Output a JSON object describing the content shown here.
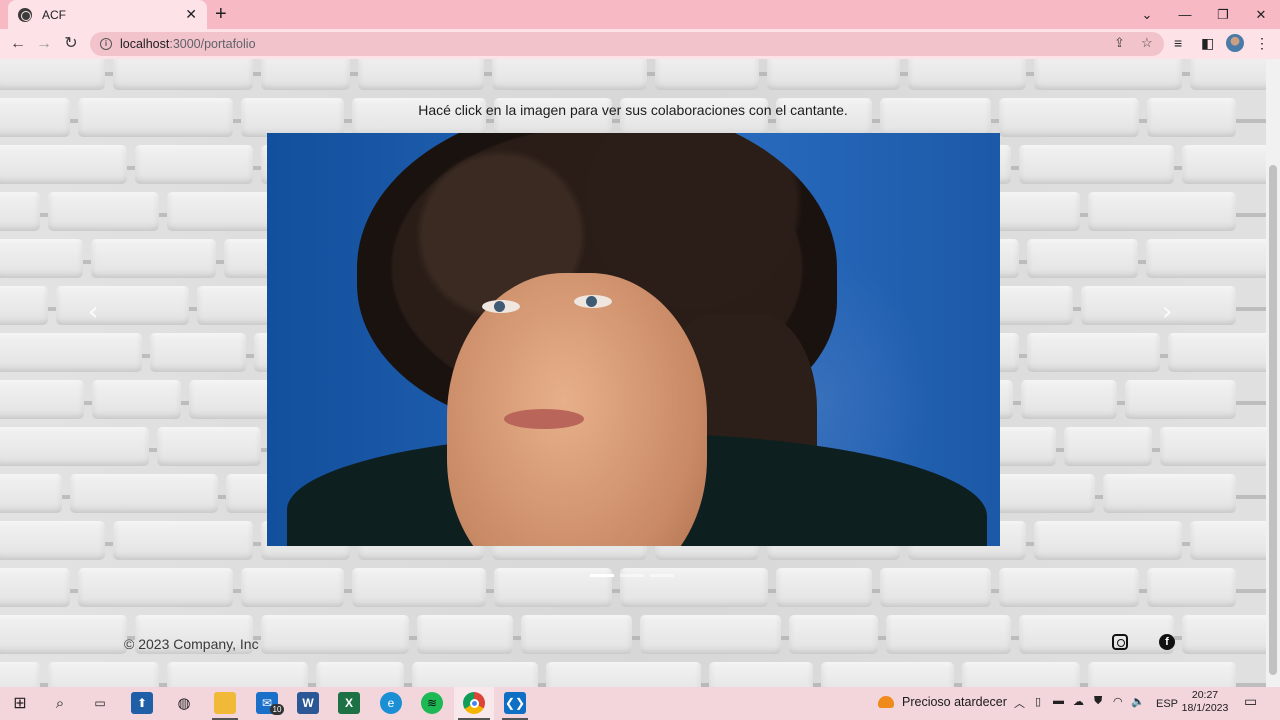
{
  "browser": {
    "tab_title": "ACF",
    "tab_close": "✕",
    "new_tab": "+",
    "url_host": "localhost",
    "url_path": ":3000/portafolio",
    "window_controls": [
      "⌄",
      "—",
      "❐",
      "✕"
    ]
  },
  "page": {
    "hint": "Hacé click en la imagen para ver sus colaboraciones con el cantante.",
    "carousel": {
      "prev": "‹",
      "next": "›",
      "slide_count": 3,
      "active_index": 0
    },
    "footer": {
      "copyright": "© 2023 Company, Inc",
      "social": [
        "instagram-icon",
        "facebook-icon"
      ]
    }
  },
  "taskbar": {
    "apps": [
      "start-icon",
      "search-icon",
      "task-view-icon",
      "app-icon",
      "globe-app-icon",
      "file-explorer-icon",
      "mail-icon",
      "word-icon",
      "excel-icon",
      "edge-icon",
      "spotify-icon",
      "chrome-icon",
      "vscode-icon"
    ],
    "mail_badge": "10",
    "weather": "Precioso atardecer",
    "language": "ESP",
    "time": "20:27",
    "date": "18/1/2023"
  },
  "colors": {
    "tab_strip": "#f7b9c4",
    "toolbar": "#fde3e7",
    "photo_bg": "#1f5fae"
  }
}
